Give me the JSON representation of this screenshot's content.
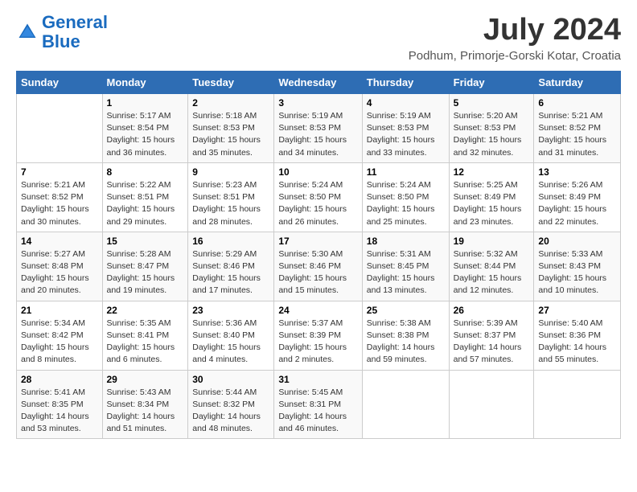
{
  "header": {
    "logo_general": "General",
    "logo_blue": "Blue",
    "month_title": "July 2024",
    "location": "Podhum, Primorje-Gorski Kotar, Croatia"
  },
  "days_of_week": [
    "Sunday",
    "Monday",
    "Tuesday",
    "Wednesday",
    "Thursday",
    "Friday",
    "Saturday"
  ],
  "weeks": [
    [
      {
        "num": "",
        "info": ""
      },
      {
        "num": "1",
        "info": "Sunrise: 5:17 AM\nSunset: 8:54 PM\nDaylight: 15 hours\nand 36 minutes."
      },
      {
        "num": "2",
        "info": "Sunrise: 5:18 AM\nSunset: 8:53 PM\nDaylight: 15 hours\nand 35 minutes."
      },
      {
        "num": "3",
        "info": "Sunrise: 5:19 AM\nSunset: 8:53 PM\nDaylight: 15 hours\nand 34 minutes."
      },
      {
        "num": "4",
        "info": "Sunrise: 5:19 AM\nSunset: 8:53 PM\nDaylight: 15 hours\nand 33 minutes."
      },
      {
        "num": "5",
        "info": "Sunrise: 5:20 AM\nSunset: 8:53 PM\nDaylight: 15 hours\nand 32 minutes."
      },
      {
        "num": "6",
        "info": "Sunrise: 5:21 AM\nSunset: 8:52 PM\nDaylight: 15 hours\nand 31 minutes."
      }
    ],
    [
      {
        "num": "7",
        "info": "Sunrise: 5:21 AM\nSunset: 8:52 PM\nDaylight: 15 hours\nand 30 minutes."
      },
      {
        "num": "8",
        "info": "Sunrise: 5:22 AM\nSunset: 8:51 PM\nDaylight: 15 hours\nand 29 minutes."
      },
      {
        "num": "9",
        "info": "Sunrise: 5:23 AM\nSunset: 8:51 PM\nDaylight: 15 hours\nand 28 minutes."
      },
      {
        "num": "10",
        "info": "Sunrise: 5:24 AM\nSunset: 8:50 PM\nDaylight: 15 hours\nand 26 minutes."
      },
      {
        "num": "11",
        "info": "Sunrise: 5:24 AM\nSunset: 8:50 PM\nDaylight: 15 hours\nand 25 minutes."
      },
      {
        "num": "12",
        "info": "Sunrise: 5:25 AM\nSunset: 8:49 PM\nDaylight: 15 hours\nand 23 minutes."
      },
      {
        "num": "13",
        "info": "Sunrise: 5:26 AM\nSunset: 8:49 PM\nDaylight: 15 hours\nand 22 minutes."
      }
    ],
    [
      {
        "num": "14",
        "info": "Sunrise: 5:27 AM\nSunset: 8:48 PM\nDaylight: 15 hours\nand 20 minutes."
      },
      {
        "num": "15",
        "info": "Sunrise: 5:28 AM\nSunset: 8:47 PM\nDaylight: 15 hours\nand 19 minutes."
      },
      {
        "num": "16",
        "info": "Sunrise: 5:29 AM\nSunset: 8:46 PM\nDaylight: 15 hours\nand 17 minutes."
      },
      {
        "num": "17",
        "info": "Sunrise: 5:30 AM\nSunset: 8:46 PM\nDaylight: 15 hours\nand 15 minutes."
      },
      {
        "num": "18",
        "info": "Sunrise: 5:31 AM\nSunset: 8:45 PM\nDaylight: 15 hours\nand 13 minutes."
      },
      {
        "num": "19",
        "info": "Sunrise: 5:32 AM\nSunset: 8:44 PM\nDaylight: 15 hours\nand 12 minutes."
      },
      {
        "num": "20",
        "info": "Sunrise: 5:33 AM\nSunset: 8:43 PM\nDaylight: 15 hours\nand 10 minutes."
      }
    ],
    [
      {
        "num": "21",
        "info": "Sunrise: 5:34 AM\nSunset: 8:42 PM\nDaylight: 15 hours\nand 8 minutes."
      },
      {
        "num": "22",
        "info": "Sunrise: 5:35 AM\nSunset: 8:41 PM\nDaylight: 15 hours\nand 6 minutes."
      },
      {
        "num": "23",
        "info": "Sunrise: 5:36 AM\nSunset: 8:40 PM\nDaylight: 15 hours\nand 4 minutes."
      },
      {
        "num": "24",
        "info": "Sunrise: 5:37 AM\nSunset: 8:39 PM\nDaylight: 15 hours\nand 2 minutes."
      },
      {
        "num": "25",
        "info": "Sunrise: 5:38 AM\nSunset: 8:38 PM\nDaylight: 14 hours\nand 59 minutes."
      },
      {
        "num": "26",
        "info": "Sunrise: 5:39 AM\nSunset: 8:37 PM\nDaylight: 14 hours\nand 57 minutes."
      },
      {
        "num": "27",
        "info": "Sunrise: 5:40 AM\nSunset: 8:36 PM\nDaylight: 14 hours\nand 55 minutes."
      }
    ],
    [
      {
        "num": "28",
        "info": "Sunrise: 5:41 AM\nSunset: 8:35 PM\nDaylight: 14 hours\nand 53 minutes."
      },
      {
        "num": "29",
        "info": "Sunrise: 5:43 AM\nSunset: 8:34 PM\nDaylight: 14 hours\nand 51 minutes."
      },
      {
        "num": "30",
        "info": "Sunrise: 5:44 AM\nSunset: 8:32 PM\nDaylight: 14 hours\nand 48 minutes."
      },
      {
        "num": "31",
        "info": "Sunrise: 5:45 AM\nSunset: 8:31 PM\nDaylight: 14 hours\nand 46 minutes."
      },
      {
        "num": "",
        "info": ""
      },
      {
        "num": "",
        "info": ""
      },
      {
        "num": "",
        "info": ""
      }
    ]
  ]
}
